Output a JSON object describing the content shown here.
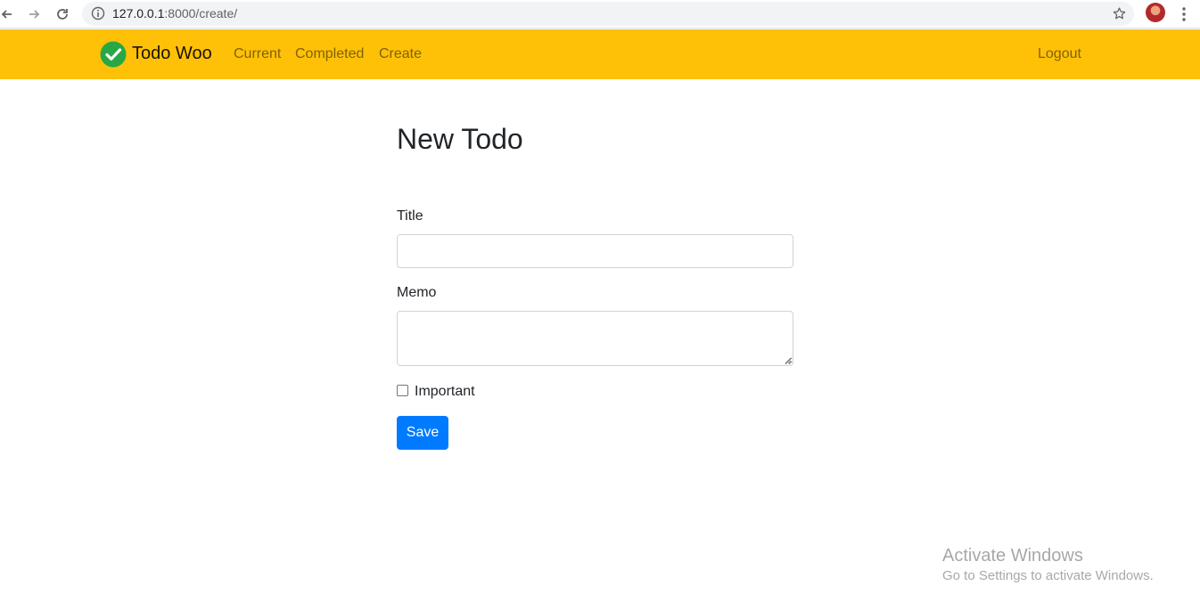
{
  "browser": {
    "url_host": "127.0.0.1",
    "url_path": ":8000/create/",
    "icons": {
      "back": "arrow-left-icon",
      "forward": "arrow-right-icon",
      "reload": "reload-icon",
      "info": "info-icon",
      "bookmark": "star-icon",
      "menu": "kebab-menu-icon"
    }
  },
  "navbar": {
    "brand": "Todo Woo",
    "links": [
      "Current",
      "Completed",
      "Create"
    ],
    "logout": "Logout",
    "background_color": "#ffc107"
  },
  "form": {
    "heading": "New Todo",
    "title_label": "Title",
    "title_value": "",
    "memo_label": "Memo",
    "memo_value": "",
    "important_label": "Important",
    "important_checked": false,
    "save_label": "Save",
    "save_color": "#007bff"
  },
  "watermark": {
    "title": "Activate Windows",
    "subtitle": "Go to Settings to activate Windows."
  }
}
